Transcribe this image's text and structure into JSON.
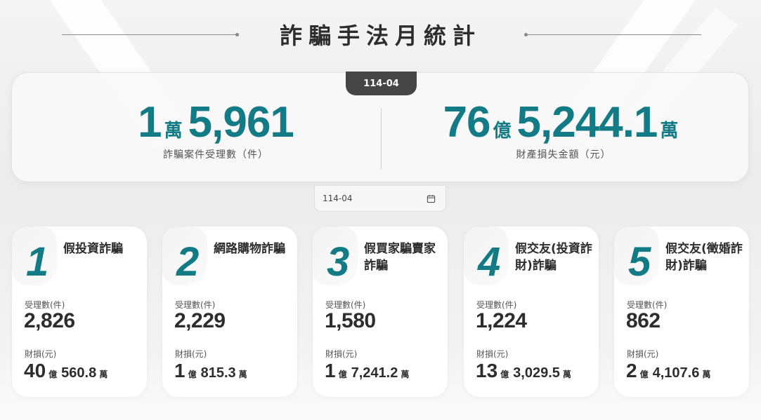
{
  "header": {
    "title": "詐騙手法月統計"
  },
  "summary": {
    "period": "114-04",
    "cases": {
      "value_wan": "1",
      "unit_wan": "萬",
      "value_rest": "5,961",
      "caption": "詐騙案件受理數（件）"
    },
    "loss": {
      "value_yi": "76",
      "unit_yi": "億",
      "value_wan": "5,244.1",
      "unit_wan": "萬",
      "caption": "財產損失金額（元）"
    }
  },
  "date_picker": {
    "value": "114-04",
    "icon": "calendar-icon"
  },
  "cards": [
    {
      "rank": "1",
      "name": "假投資詐騙",
      "count_label": "受理數(件)",
      "count": "2,826",
      "loss_label": "財損(元)",
      "loss_yi": "40",
      "loss_yi_unit": "億",
      "loss_wan": "560.8",
      "loss_wan_unit": "萬"
    },
    {
      "rank": "2",
      "name": "網路購物詐騙",
      "count_label": "受理數(件)",
      "count": "2,229",
      "loss_label": "財損(元)",
      "loss_yi": "1",
      "loss_yi_unit": "億",
      "loss_wan": "815.3",
      "loss_wan_unit": "萬"
    },
    {
      "rank": "3",
      "name": "假買家騙賣家詐騙",
      "count_label": "受理數(件)",
      "count": "1,580",
      "loss_label": "財損(元)",
      "loss_yi": "1",
      "loss_yi_unit": "億",
      "loss_wan": "7,241.2",
      "loss_wan_unit": "萬"
    },
    {
      "rank": "4",
      "name": "假交友(投資詐財)詐騙",
      "count_label": "受理數(件)",
      "count": "1,224",
      "loss_label": "財損(元)",
      "loss_yi": "13",
      "loss_yi_unit": "億",
      "loss_wan": "3,029.5",
      "loss_wan_unit": "萬"
    },
    {
      "rank": "5",
      "name": "假交友(徵婚詐財)詐騙",
      "count_label": "受理數(件)",
      "count": "862",
      "loss_label": "財損(元)",
      "loss_yi": "2",
      "loss_yi_unit": "億",
      "loss_wan": "4,107.6",
      "loss_wan_unit": "萬"
    }
  ],
  "colors": {
    "accent": "#127b85",
    "tab_bg": "#454545",
    "text": "#2d2d2d"
  }
}
